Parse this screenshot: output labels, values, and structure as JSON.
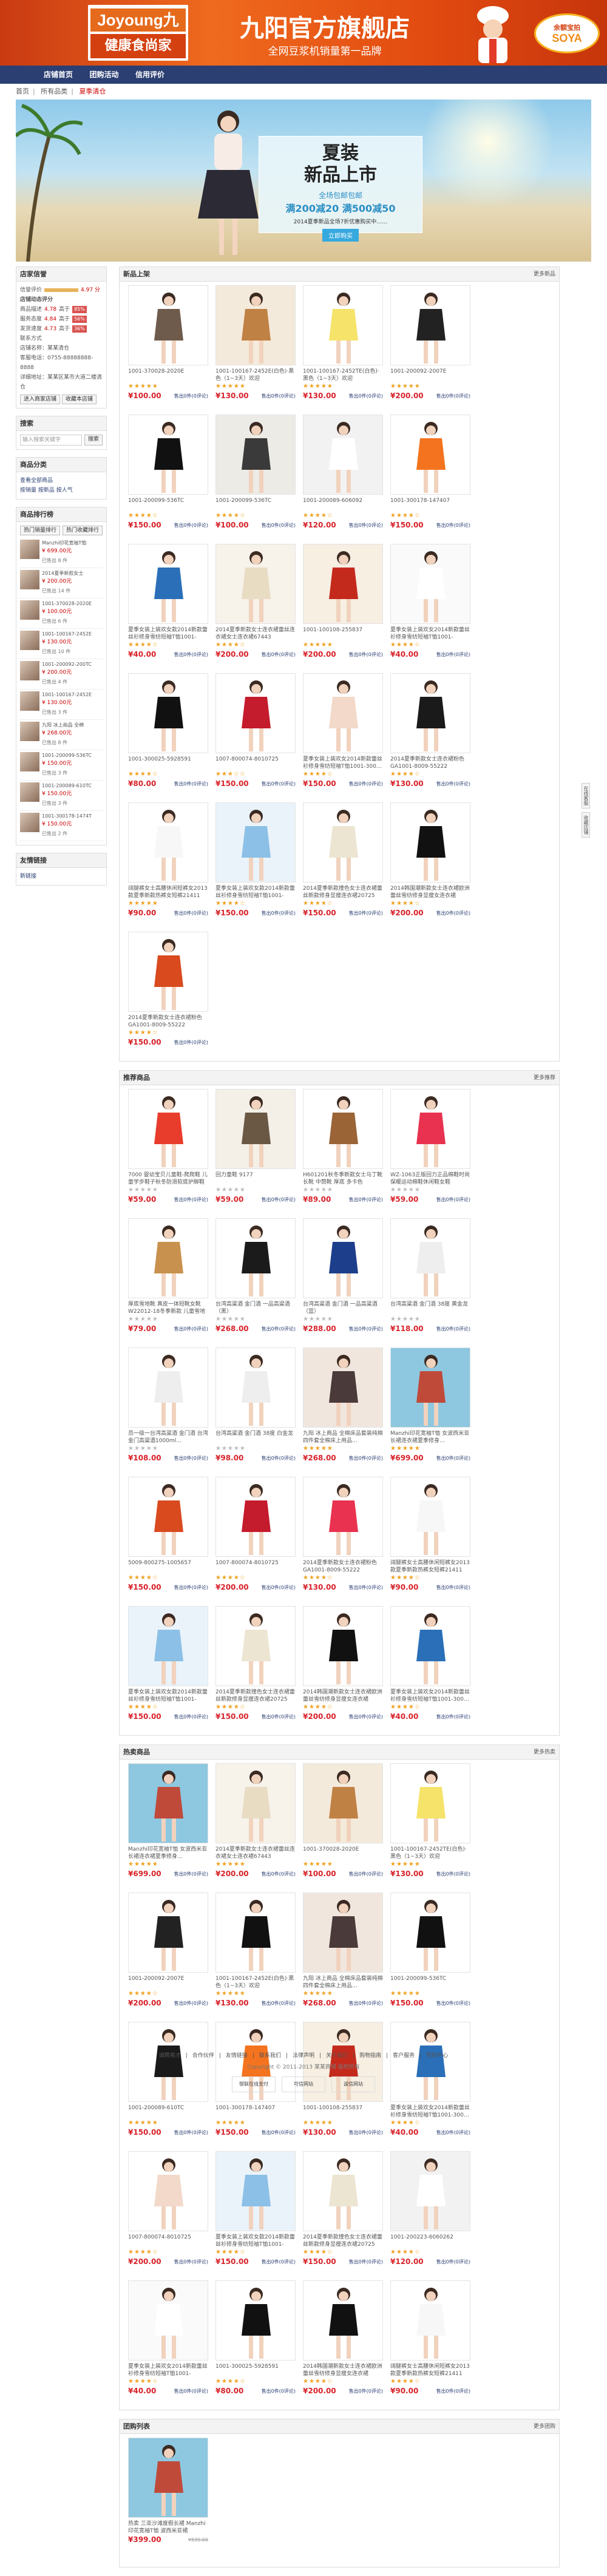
{
  "header": {
    "logo_en": "Joyoung九阳",
    "logo_cn": "健康食尚家",
    "title": "九阳官方旗舰店",
    "subtitle": "全网豆浆机销量第一品牌",
    "badge_top": "余额宝拍",
    "badge_bottom": "SOYA"
  },
  "nav": [
    "店铺首页",
    "团购活动",
    "信用评价"
  ],
  "breadcrumb": [
    "首页",
    "所有品类",
    "夏季清仓"
  ],
  "banner": {
    "line1": "夏装",
    "line2": "新品上市",
    "line3": "全场包邮包邮",
    "line4": "满200减20 满500减50",
    "line5": "2014夏季新品全场7折优惠购买中……",
    "button": "立即购买"
  },
  "sidebar": {
    "shop_title": "店家信誉",
    "rating_label": "信誉评价",
    "rating_value": "4.97 分",
    "dsr_title": "店铺动态评分",
    "dsr": [
      {
        "label": "商品描述",
        "score": "4.78",
        "rank": "高于",
        "pct": "85%"
      },
      {
        "label": "服务态度",
        "score": "4.84",
        "rank": "高于",
        "pct": "56%"
      },
      {
        "label": "发货速度",
        "score": "4.73",
        "rank": "高于",
        "pct": "36%"
      }
    ],
    "contact_label": "联系方式",
    "info": [
      "店铺名称：某某清仓",
      "客服电话：0755-88888888-8888",
      "详细地址：某某区某市大道二楼清仓"
    ],
    "btn1": "进入商家店铺",
    "btn2": "收藏本店铺",
    "search_title": "搜索",
    "search_placeholder": "输入搜索关键字",
    "search_btn": "搜索",
    "cat_title": "商品分类",
    "cat_items": [
      "查看全部商品",
      "按销量",
      "按新品",
      "按人气"
    ],
    "rank_title": "商品排行榜",
    "rank_tabs": [
      "热门销量排行",
      "热门收藏排行"
    ],
    "rank": [
      {
        "t": "Manzhi印花宽袖T恤",
        "p": "¥ 699.00元",
        "s": "已售出 8 件"
      },
      {
        "t": "2014夏季新款女士",
        "p": "¥ 200.00元",
        "s": "已售出 14 件"
      },
      {
        "t": "1001-370028-2020E",
        "p": "¥ 100.00元",
        "s": "已售出 6 件"
      },
      {
        "t": "1001-100167-2452E",
        "p": "¥ 130.00元",
        "s": "已售出 10 件"
      },
      {
        "t": "1001-200092-200TC",
        "p": "¥ 200.00元",
        "s": "已售出 4 件"
      },
      {
        "t": "1001-100167-2452E",
        "p": "¥ 130.00元",
        "s": "已售出 3 件"
      },
      {
        "t": "九阳 冰上商品 全棉",
        "p": "¥ 268.00元",
        "s": "已售出 8 件"
      },
      {
        "t": "1001-200099-536TC",
        "p": "¥ 150.00元",
        "s": "已售出 3 件"
      },
      {
        "t": "1001-200089-610TC",
        "p": "¥ 150.00元",
        "s": "已售出 3 件"
      },
      {
        "t": "1001-300178-1474T",
        "p": "¥ 150.00元",
        "s": "已售出 2 件"
      }
    ],
    "friend_title": "友情链接",
    "friend_items": [
      "新链接"
    ]
  },
  "sections": [
    {
      "title": "新品上架",
      "more": "更多新品",
      "items": [
        {
          "t": "1001-370028-2020E",
          "p": "¥100.00",
          "s": "售出0件(0评论)",
          "c": [
            "#6f5b4c",
            "#fff"
          ],
          "st": 5
        },
        {
          "t": "1001-100167-2452E(白色)·黑色（1~3天）欢迎",
          "p": "¥130.00",
          "s": "售出0件(0评论)",
          "c": [
            "#c08144",
            "#f4eadb"
          ],
          "st": 5
        },
        {
          "t": "1001-100167-2452TE(白色)·黑色（1~3天）欢迎",
          "p": "¥130.00",
          "s": "售出0件(0评论)",
          "c": [
            "#f5e36a",
            "#fff"
          ],
          "st": 5
        },
        {
          "t": "1001-200092-2007E",
          "p": "¥200.00",
          "s": "售出0件(0评论)",
          "c": [
            "#222",
            "#fff"
          ],
          "st": 5
        },
        {
          "t": "1001-200099-536TC",
          "p": "¥150.00",
          "s": "售出0件(0评论)",
          "c": [
            "#111",
            "#fff"
          ],
          "st": 4
        },
        {
          "t": "1001-200099-536TC",
          "p": "¥100.00",
          "s": "售出0件(0评论)",
          "c": [
            "#3a3a3a",
            "#ecebe6"
          ],
          "st": 4
        },
        {
          "t": "1001-200089-606092",
          "p": "¥120.00",
          "s": "售出0件(0评论)",
          "c": [
            "#fff",
            "#f2f2f2"
          ],
          "st": 4
        },
        {
          "t": "1001-300178-147407",
          "p": "¥150.00",
          "s": "售出0件(0评论)",
          "c": [
            "#f4731e",
            "#fff"
          ],
          "st": 4
        },
        {
          "t": "夏季女装上装欢女款2014新款蕾丝衫修身雪纺短袖T恤1001-300…",
          "p": "¥40.00",
          "s": "售出0件(0评论)",
          "c": [
            "#2a6fb8",
            "#fff"
          ],
          "st": 4
        },
        {
          "t": "2014夏季新款女士连衣裙蕾丝连衣裙女士连衣裙67443",
          "p": "¥200.00",
          "s": "售出0件(0评论)",
          "c": [
            "#e8dcc3",
            "#f7f2ea"
          ],
          "st": 4
        },
        {
          "t": "1001-100108-255837",
          "p": "¥200.00",
          "s": "售出0件(0评论)",
          "c": [
            "#c42a1c",
            "#f6efe2"
          ],
          "st": 5
        },
        {
          "t": "夏季女装上装欢女2014新款蕾丝衫修身雪纺短袖T恤1001-300025…",
          "p": "¥40.00",
          "s": "售出0件(0评论)",
          "c": [
            "#fff",
            "#fafafa"
          ],
          "st": 4
        },
        {
          "t": "1001-300025-5928591",
          "p": "¥80.00",
          "s": "售出0件(0评论)",
          "c": [
            "#111",
            "#fff"
          ],
          "st": 4
        },
        {
          "t": "1007-800074-8010725",
          "p": "¥150.00",
          "s": "售出0件(0评论)",
          "c": [
            "#c41b2d",
            "#fff"
          ],
          "st": 3
        },
        {
          "t": "夏季女装上装欢女2014新款蕾丝衫修身雪纺短袖T恤1001-300…",
          "p": "¥150.00",
          "s": "售出0件(0评论)",
          "c": [
            "#f2d9c9",
            "#fff"
          ],
          "st": 4
        },
        {
          "t": "2014夏季新款女士连衣裙粉色 GA1001-8009-55222",
          "p": "¥130.00",
          "s": "售出0件(0评论)",
          "c": [
            "#1a1a1a",
            "#fff"
          ],
          "st": 4
        },
        {
          "t": "阔腿裤女士高腰休闲短裤女2013款夏季新款热裤女短裤21411",
          "p": "¥90.00",
          "s": "售出0件(0评论)",
          "c": [
            "#f7f7f7",
            "#fff"
          ],
          "st": 5
        },
        {
          "t": "夏季女装上装欢女款2014新款蕾丝衫修身雪纺短袖T恤1001-300…",
          "p": "¥150.00",
          "s": "售出0件(0评论)",
          "c": [
            "#8cc0e6",
            "#eaf3fa"
          ],
          "st": 4
        },
        {
          "t": "2014夏季新款撞色女士连衣裙蕾丝新款修身显瘦连衣裙20725",
          "p": "¥150.00",
          "s": "售出0件(0评论)",
          "c": [
            "#ece5d1",
            "#fff"
          ],
          "st": 4
        },
        {
          "t": "2014韩国潮新款女士连衣裙欧洲蕾丝雪纺修身显瘦女连衣裙",
          "p": "¥200.00",
          "s": "售出0件(0评论)",
          "c": [
            "#111",
            "#fff"
          ],
          "st": 4
        },
        {
          "t": "2014夏季新款女士连衣裙粉色 GA1001-8009-55222",
          "p": "¥150.00",
          "s": "售出0件(0评论)",
          "c": [
            "#d94a1f",
            "#fff"
          ],
          "st": 4
        }
      ]
    },
    {
      "title": "推荐商品",
      "more": "更多推荐",
      "items": [
        {
          "t": "7000 婴幼宝贝儿童鞋-爬爬鞋 儿童学步鞋子秋冬防滑软底护脚鞋",
          "p": "¥59.00",
          "s": "售出0件(0评论)",
          "c": [
            "#e83c2c",
            "#fff"
          ],
          "st": 0
        },
        {
          "t": "回力童鞋 9177",
          "p": "¥59.00",
          "s": "售出0件(0评论)",
          "c": [
            "#6b5844",
            "#f4f0e8"
          ],
          "st": 0
        },
        {
          "t": "H601201秋冬季新款女士马丁靴长靴 中筒靴 厚底 多卡色",
          "p": "¥89.00",
          "s": "售出0件(0评论)",
          "c": [
            "#9a6437",
            "#fff"
          ],
          "st": 0
        },
        {
          "t": "WZ-1063正版回力正品棉鞋时尚保暖运动棉鞋休闲鞋女鞋",
          "p": "¥59.00",
          "s": "售出0件(0评论)",
          "c": [
            "#e8324f",
            "#fff"
          ],
          "st": 0
        },
        {
          "t": "厚底雪地靴 真皮一体短靴女靴 W22012-18冬季新款 儿童雪地靴",
          "p": "¥79.00",
          "s": "售出0件(0评论)",
          "c": [
            "#c8914d",
            "#fff"
          ],
          "st": 0
        },
        {
          "t": "台湾高粱酒 金门酒 一品高粱酒（黑）",
          "p": "¥268.00",
          "s": "售出0件(0评论)",
          "c": [
            "#1b1b1b",
            "#fff"
          ],
          "st": 0
        },
        {
          "t": "台湾高粱酒 金门酒 一品高粱酒（蓝）",
          "p": "¥288.00",
          "s": "售出0件(0评论)",
          "c": [
            "#1d3e8a",
            "#fff"
          ],
          "st": 0
        },
        {
          "t": "台湾高粱酒 金门酒 38度 黄金龙",
          "p": "¥118.00",
          "s": "售出0件(0评论)",
          "c": [
            "#eeeeee",
            "#fff"
          ],
          "st": 0
        },
        {
          "t": "员一级一台湾高粱酒 金门酒 台湾金门高粱酒1000ml…",
          "p": "¥108.00",
          "s": "售出0件(0评论)",
          "c": [
            "#eeeeee",
            "#fff"
          ],
          "st": 0
        },
        {
          "t": "台湾高粱酒 金门酒 38度 白金龙",
          "p": "¥98.00",
          "s": "售出0件(0评论)",
          "c": [
            "#eeeeee",
            "#fff"
          ],
          "st": 0
        },
        {
          "t": "九阳 冰上商品 全棉床品套装纯棉四件套全棉床上用品…",
          "p": "¥268.00",
          "s": "售出0件(0评论)",
          "c": [
            "#4a3a3a",
            "#f1e6dd"
          ],
          "st": 5
        },
        {
          "t": "Manzhi印花宽袖T恤 女波西米亚长裙连衣裙夏季修身…",
          "p": "¥699.00",
          "s": "售出0件(0评论)",
          "c": [
            "#c04a3a",
            "#8ec7e0"
          ],
          "st": 5
        },
        {
          "t": "5009-800275-1005657",
          "p": "¥150.00",
          "s": "售出0件(0评论)",
          "c": [
            "#d94a1f",
            "#fff"
          ],
          "st": 4
        },
        {
          "t": "1007-800074-8010725",
          "p": "¥200.00",
          "s": "售出0件(0评论)",
          "c": [
            "#c41b2d",
            "#fff"
          ],
          "st": 4
        },
        {
          "t": "2014夏季新款女士连衣裙粉色 GA1001-8009-55222",
          "p": "¥130.00",
          "s": "售出0件(0评论)",
          "c": [
            "#e8324f",
            "#fff"
          ],
          "st": 4
        },
        {
          "t": "阔腿裤女士高腰休闲短裤女2013款夏季新款热裤女短裤21411",
          "p": "¥90.00",
          "s": "售出0件(0评论)",
          "c": [
            "#f7f7f7",
            "#fff"
          ],
          "st": 4
        },
        {
          "t": "夏季女装上装欢女款2014新款蕾丝衫修身雪纺短袖T恤1001-300…",
          "p": "¥150.00",
          "s": "售出0件(0评论)",
          "c": [
            "#8cc0e6",
            "#eaf3fa"
          ],
          "st": 4
        },
        {
          "t": "2014夏季新款撞色女士连衣裙蕾丝新款修身显瘦连衣裙20725",
          "p": "¥150.00",
          "s": "售出0件(0评论)",
          "c": [
            "#ece5d1",
            "#fff"
          ],
          "st": 4
        },
        {
          "t": "2014韩国潮新款女士连衣裙欧洲蕾丝雪纺修身显瘦女连衣裙",
          "p": "¥200.00",
          "s": "售出0件(0评论)",
          "c": [
            "#111",
            "#fff"
          ],
          "st": 4
        },
        {
          "t": "夏季女装上装欢女2014新款蕾丝衫修身雪纺短袖T恤1001-300…",
          "p": "¥40.00",
          "s": "售出0件(0评论)",
          "c": [
            "#2a6fb8",
            "#fff"
          ],
          "st": 4
        }
      ]
    },
    {
      "title": "热卖商品",
      "more": "更多热卖",
      "items": [
        {
          "t": "Manzhi印花宽袖T恤 女波西米亚长裙连衣裙夏季修身…",
          "p": "¥699.00",
          "s": "售出0件(0评论)",
          "c": [
            "#c04a3a",
            "#8ec7e0"
          ],
          "st": 5
        },
        {
          "t": "2014夏季新款女士连衣裙蕾丝连衣裙女士连衣裙67443",
          "p": "¥200.00",
          "s": "售出0件(0评论)",
          "c": [
            "#e8dcc3",
            "#f7f2ea"
          ],
          "st": 5
        },
        {
          "t": "1001-370028-2020E",
          "p": "¥100.00",
          "s": "售出0件(0评论)",
          "c": [
            "#c08144",
            "#f4eadb"
          ],
          "st": 5
        },
        {
          "t": "1001-100167-2452TE(白色)·黑色（1~3天）欢迎",
          "p": "¥130.00",
          "s": "售出0件(0评论)",
          "c": [
            "#f5e36a",
            "#fff"
          ],
          "st": 5
        },
        {
          "t": "1001-200092-2007E",
          "p": "¥200.00",
          "s": "售出0件(0评论)",
          "c": [
            "#222",
            "#fff"
          ],
          "st": 4
        },
        {
          "t": "1001-100167-2452E(白色)·黑色（1~3天）欢迎",
          "p": "¥130.00",
          "s": "售出0件(0评论)",
          "c": [
            "#111",
            "#fff"
          ],
          "st": 5
        },
        {
          "t": "九阳 冰上商品 全棉床品套装纯棉四件套全棉床上用品…",
          "p": "¥268.00",
          "s": "售出0件(0评论)",
          "c": [
            "#4a3a3a",
            "#f1e6dd"
          ],
          "st": 5
        },
        {
          "t": "1001-200099-536TC",
          "p": "¥150.00",
          "s": "售出0件(0评论)",
          "c": [
            "#111",
            "#fff"
          ],
          "st": 5
        },
        {
          "t": "1001-200089-610TC",
          "p": "¥150.00",
          "s": "售出0件(0评论)",
          "c": [
            "#1a1a1a",
            "#fff"
          ],
          "st": 5
        },
        {
          "t": "1001-300178-147407",
          "p": "¥150.00",
          "s": "售出0件(0评论)",
          "c": [
            "#f4731e",
            "#fff"
          ],
          "st": 5
        },
        {
          "t": "1001-100108-255837",
          "p": "¥130.00",
          "s": "售出0件(0评论)",
          "c": [
            "#c42a1c",
            "#f6efe2"
          ],
          "st": 5
        },
        {
          "t": "夏季女装上装欢女2014新款蕾丝衫修身雪纺短袖T恤1001-300…",
          "p": "¥40.00",
          "s": "售出0件(0评论)",
          "c": [
            "#2a6fb8",
            "#fff"
          ],
          "st": 4
        },
        {
          "t": "1007-800074-8010725",
          "p": "¥200.00",
          "s": "售出0件(0评论)",
          "c": [
            "#f2d9c9",
            "#fff"
          ],
          "st": 4
        },
        {
          "t": "夏季女装上装欢女款2014新款蕾丝衫修身雪纺短袖T恤1001-300…",
          "p": "¥150.00",
          "s": "售出0件(0评论)",
          "c": [
            "#8cc0e6",
            "#eaf3fa"
          ],
          "st": 4
        },
        {
          "t": "2014夏季新款撞色女士连衣裙蕾丝新款修身显瘦连衣裙20725",
          "p": "¥150.00",
          "s": "售出0件(0评论)",
          "c": [
            "#ece5d1",
            "#fff"
          ],
          "st": 4
        },
        {
          "t": "1001-200223-6060262",
          "p": "¥120.00",
          "s": "售出0件(0评论)",
          "c": [
            "#fff",
            "#f2f2f2"
          ],
          "st": 4
        },
        {
          "t": "夏季女装上装欢女2014新款蕾丝衫修身雪纺短袖T恤1001-300025…",
          "p": "¥40.00",
          "s": "售出0件(0评论)",
          "c": [
            "#fff",
            "#fafafa"
          ],
          "st": 4
        },
        {
          "t": "1001-300025-5928591",
          "p": "¥80.00",
          "s": "售出0件(0评论)",
          "c": [
            "#111",
            "#fff"
          ],
          "st": 4
        },
        {
          "t": "2014韩国潮新款女士连衣裙欧洲蕾丝雪纺修身显瘦女连衣裙",
          "p": "¥200.00",
          "s": "售出0件(0评论)",
          "c": [
            "#111",
            "#fff"
          ],
          "st": 4
        },
        {
          "t": "阔腿裤女士高腰休闲短裤女2013款夏季新款热裤女短裤21411",
          "p": "¥90.00",
          "s": "售出0件(0评论)",
          "c": [
            "#f7f7f7",
            "#fff"
          ],
          "st": 4
        }
      ]
    },
    {
      "title": "团购列表",
      "more": "更多团购",
      "items": [
        {
          "t": "热卖 三亚沙滩度假长裙 Manzhi印花宽袖T恤 波西米亚裙",
          "p": "¥399.00",
          "s": "¥599.00",
          "c": [
            "#c04a3a",
            "#8ec7e0"
          ],
          "st": -1
        }
      ]
    }
  ],
  "right_tabs": [
    "在线客服",
    "收藏店铺"
  ],
  "footer": {
    "links": [
      "诚聘英才",
      "合作伙伴",
      "友情链接",
      "联系我们",
      "法律声明",
      "关于我们",
      "购物指南",
      "客户服务",
      "帮助中心"
    ],
    "copy": "Copyright © 2011-2013 某某商城 版权所有",
    "badges": [
      "银联在线支付",
      "可信网站",
      "诚信网站"
    ]
  }
}
